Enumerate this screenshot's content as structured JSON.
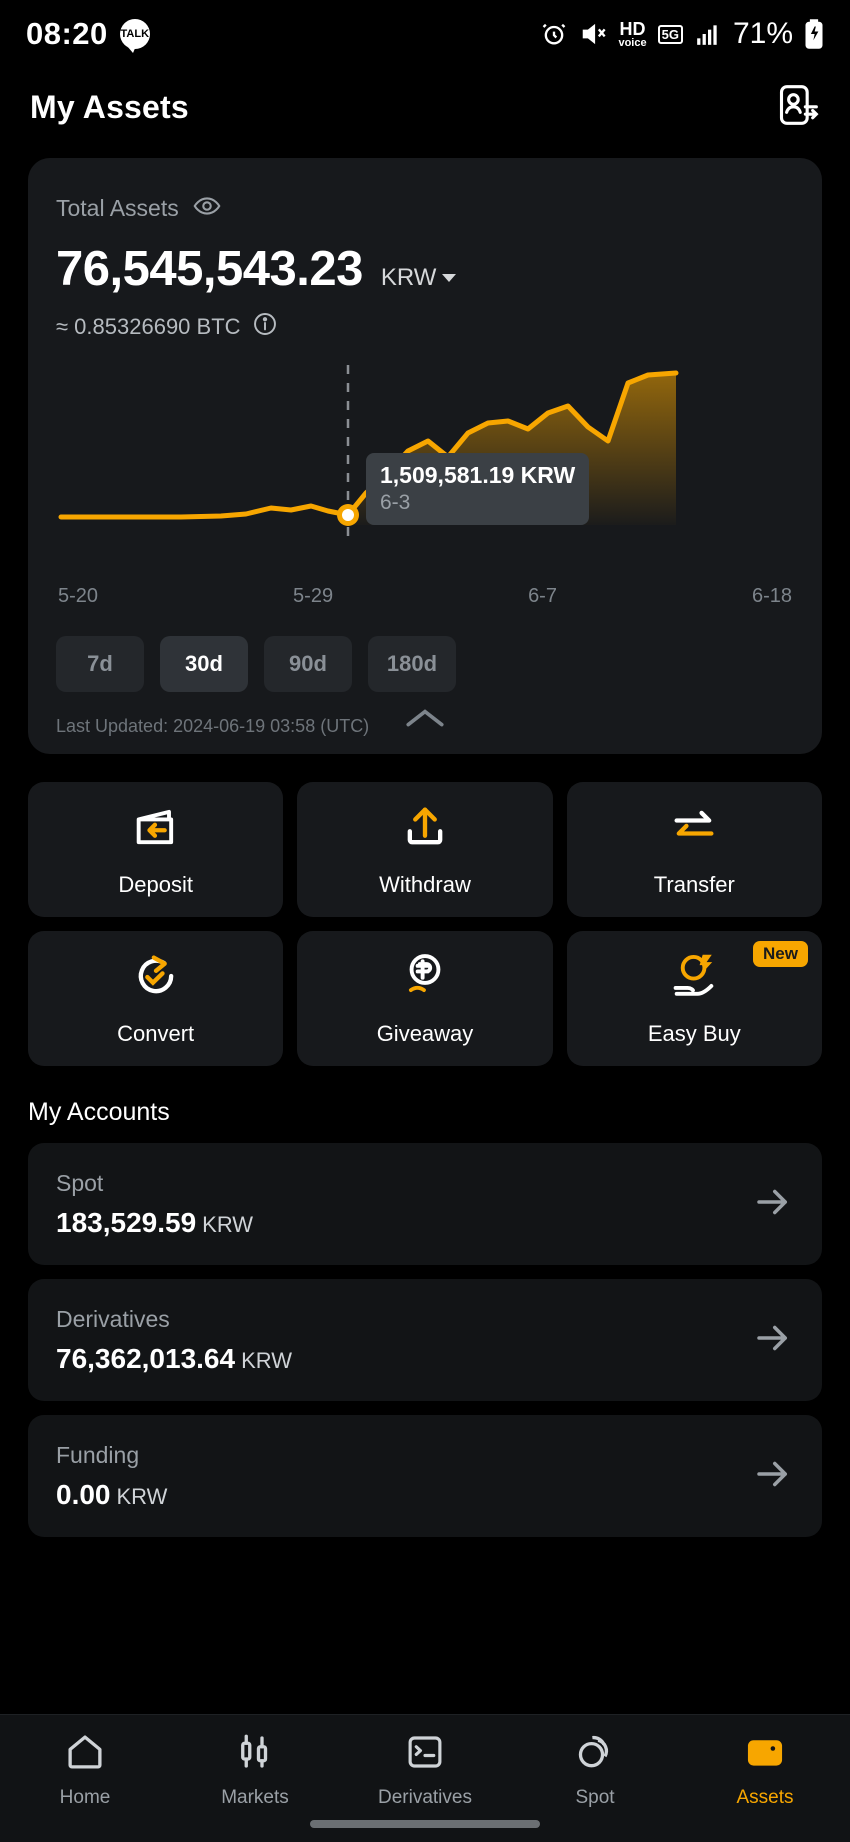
{
  "status_bar": {
    "time": "08:20",
    "talk_icon": "kakaotalk-icon",
    "alarm_icon": "alarm-icon",
    "mute_icon": "mute-icon",
    "hd_top": "HD",
    "hd_bottom": "voice",
    "network": "5G",
    "signal_icon": "signal-bars-icon",
    "battery": "71%",
    "battery_icon": "battery-charging-icon"
  },
  "header": {
    "title": "My Assets",
    "action_icon": "transfer-contact-icon"
  },
  "total_assets": {
    "label": "Total Assets",
    "eye_icon": "eye-icon",
    "amount": "76,545,543.23",
    "currency": "KRW",
    "caret_icon": "chevron-down-icon",
    "btc_equivalent": "≈ 0.85326690 BTC",
    "info_icon": "info-icon"
  },
  "chart": {
    "tooltip_value": "1,509,581.19 KRW",
    "tooltip_date": "6-3",
    "ranges": [
      {
        "label": "7d",
        "active": false
      },
      {
        "label": "30d",
        "active": true
      },
      {
        "label": "90d",
        "active": false
      },
      {
        "label": "180d",
        "active": false
      }
    ],
    "last_updated": "Last Updated: 2024-06-19 03:58 (UTC)",
    "collapse_icon": "chevron-up-icon"
  },
  "chart_data": {
    "type": "line",
    "title": "Total Assets History",
    "xlabel": "",
    "ylabel": "KRW",
    "x_tick_labels": [
      "5-20",
      "5-29",
      "6-7",
      "6-18"
    ],
    "x": [
      "5-20",
      "5-21",
      "5-22",
      "5-23",
      "5-24",
      "5-25",
      "5-26",
      "5-27",
      "5-28",
      "5-29",
      "5-30",
      "5-31",
      "6-1",
      "6-2",
      "6-3",
      "6-4",
      "6-5",
      "6-6",
      "6-7",
      "6-8",
      "6-9",
      "6-10",
      "6-11",
      "6-12",
      "6-13",
      "6-14",
      "6-15",
      "6-16",
      "6-17",
      "6-18"
    ],
    "values": [
      1490000,
      1490000,
      1490000,
      1490000,
      1490000,
      1491000,
      1492000,
      1494000,
      1498000,
      1502000,
      1505000,
      1500000,
      1503000,
      1506000,
      1509581,
      1560000,
      1650000,
      1760000,
      1830000,
      1790000,
      1865000,
      1900000,
      1905000,
      1890000,
      1935000,
      1960000,
      1905000,
      1870000,
      2050000,
      2095000
    ],
    "highlight_point": {
      "x": "6-3",
      "y": 1509581.19,
      "label": "1,509,581.19 KRW"
    },
    "ylim": [
      1400000,
      2150000
    ],
    "grid": false,
    "legend": "none",
    "line_color": "#f7a600",
    "fill": "gradient-orange"
  },
  "actions": [
    {
      "label": "Deposit",
      "icon": "deposit-wallet-icon",
      "badge": null
    },
    {
      "label": "Withdraw",
      "icon": "withdraw-upload-icon",
      "badge": null
    },
    {
      "label": "Transfer",
      "icon": "transfer-arrows-icon",
      "badge": null
    },
    {
      "label": "Convert",
      "icon": "convert-refresh-icon",
      "badge": null
    },
    {
      "label": "Giveaway",
      "icon": "giveaway-gift-hand-icon",
      "badge": null
    },
    {
      "label": "Easy Buy",
      "icon": "easy-buy-coin-hand-icon",
      "badge": "New"
    }
  ],
  "accounts": {
    "section_title": "My Accounts",
    "items": [
      {
        "name": "Spot",
        "value": "183,529.59",
        "currency": "KRW",
        "arrow_icon": "arrow-right-icon"
      },
      {
        "name": "Derivatives",
        "value": "76,362,013.64",
        "currency": "KRW",
        "arrow_icon": "arrow-right-icon"
      },
      {
        "name": "Funding",
        "value": "0.00",
        "currency": "KRW",
        "arrow_icon": "arrow-right-icon"
      }
    ]
  },
  "bottom_nav": [
    {
      "label": "Home",
      "icon": "home-icon",
      "active": false
    },
    {
      "label": "Markets",
      "icon": "markets-candles-icon",
      "active": false
    },
    {
      "label": "Derivatives",
      "icon": "derivatives-list-icon",
      "active": false
    },
    {
      "label": "Spot",
      "icon": "spot-circles-icon",
      "active": false
    },
    {
      "label": "Assets",
      "icon": "assets-wallet-icon",
      "active": true
    }
  ],
  "colors": {
    "accent": "#f7a600",
    "card_bg": "#17191c",
    "page_bg": "#000000",
    "muted_text": "#9aa0a6"
  }
}
